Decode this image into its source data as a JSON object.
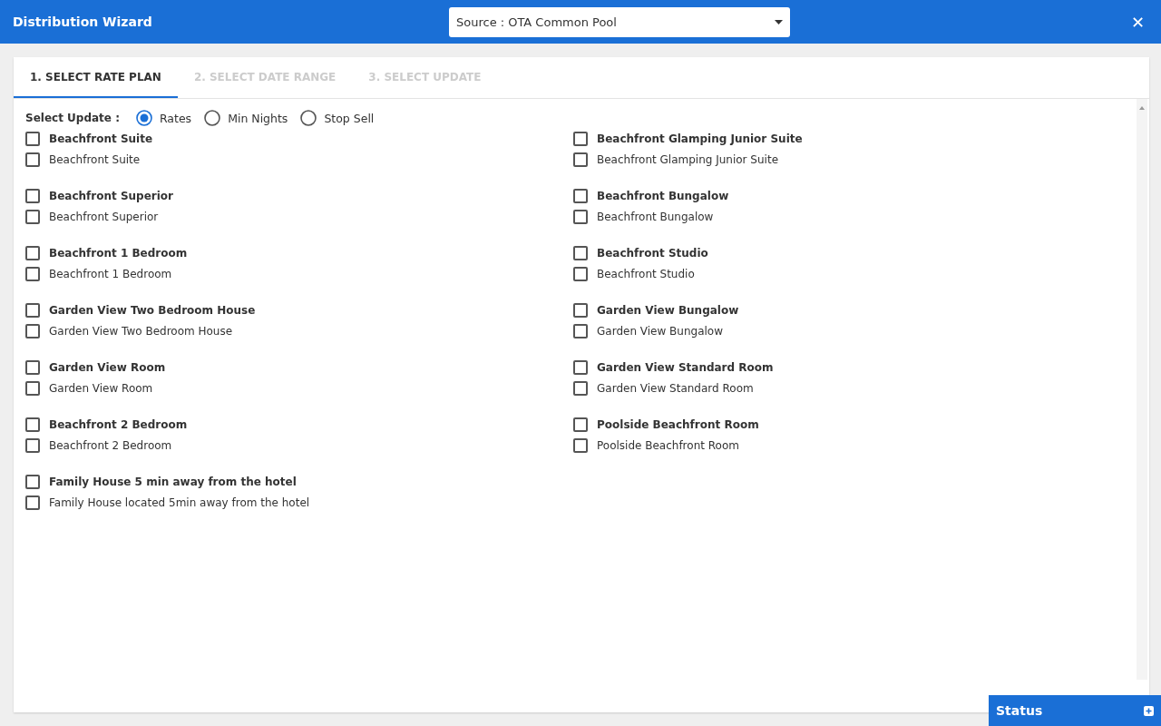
{
  "header": {
    "title": "Distribution Wizard",
    "source_select": {
      "label": "Source :",
      "value": "OTA Common Pool"
    },
    "close": "✕"
  },
  "tabs": [
    {
      "label": "1. SELECT RATE PLAN",
      "selected": true
    },
    {
      "label": "2. SELECT DATE RANGE",
      "selected": false
    },
    {
      "label": "3. SELECT UPDATE",
      "selected": false
    }
  ],
  "update_type": {
    "label": "Select Update :",
    "options": [
      {
        "label": "Rates",
        "selected": true
      },
      {
        "label": "Min Nights",
        "selected": false
      },
      {
        "label": "Stop Sell",
        "selected": false
      }
    ]
  },
  "rooms": [
    {
      "name": "Beachfront Suite",
      "checked": false,
      "rate_plans": [
        {
          "name": "Beachfront Suite",
          "checked": false
        }
      ]
    },
    {
      "name": "Beachfront Glamping Junior Suite",
      "checked": false,
      "rate_plans": [
        {
          "name": "Beachfront Glamping Junior Suite",
          "checked": false
        }
      ]
    },
    {
      "name": "Beachfront Superior",
      "checked": false,
      "rate_plans": [
        {
          "name": "Beachfront Superior",
          "checked": false
        }
      ]
    },
    {
      "name": "Beachfront Bungalow",
      "checked": false,
      "rate_plans": [
        {
          "name": "Beachfront Bungalow",
          "checked": false
        }
      ]
    },
    {
      "name": "Beachfront 1 Bedroom",
      "checked": false,
      "rate_plans": [
        {
          "name": "Beachfront 1 Bedroom",
          "checked": false
        }
      ]
    },
    {
      "name": "Beachfront Studio",
      "checked": false,
      "rate_plans": [
        {
          "name": "Beachfront Studio",
          "checked": false
        }
      ]
    },
    {
      "name": "Garden View Two Bedroom House",
      "checked": false,
      "rate_plans": [
        {
          "name": "Garden View Two Bedroom House",
          "checked": false
        }
      ]
    },
    {
      "name": "Garden View Bungalow",
      "checked": false,
      "rate_plans": [
        {
          "name": "Garden View Bungalow",
          "checked": false
        }
      ]
    },
    {
      "name": "Garden View Room",
      "checked": false,
      "rate_plans": [
        {
          "name": "Garden View Room",
          "checked": false
        }
      ]
    },
    {
      "name": "Garden View Standard Room",
      "checked": false,
      "rate_plans": [
        {
          "name": "Garden View Standard Room",
          "checked": false
        }
      ]
    },
    {
      "name": "Beachfront 2 Bedroom",
      "checked": false,
      "rate_plans": [
        {
          "name": "Beachfront 2 Bedroom",
          "checked": false
        }
      ]
    },
    {
      "name": "Poolside Beachfront Room",
      "checked": false,
      "rate_plans": [
        {
          "name": "Poolside Beachfront Room",
          "checked": false
        }
      ]
    },
    {
      "name": "Family House 5 min away from the hotel",
      "checked": false,
      "rate_plans": [
        {
          "name": "Family House located 5min away from the hotel",
          "checked": false
        }
      ]
    }
  ],
  "status_panel": {
    "title": "Status"
  }
}
